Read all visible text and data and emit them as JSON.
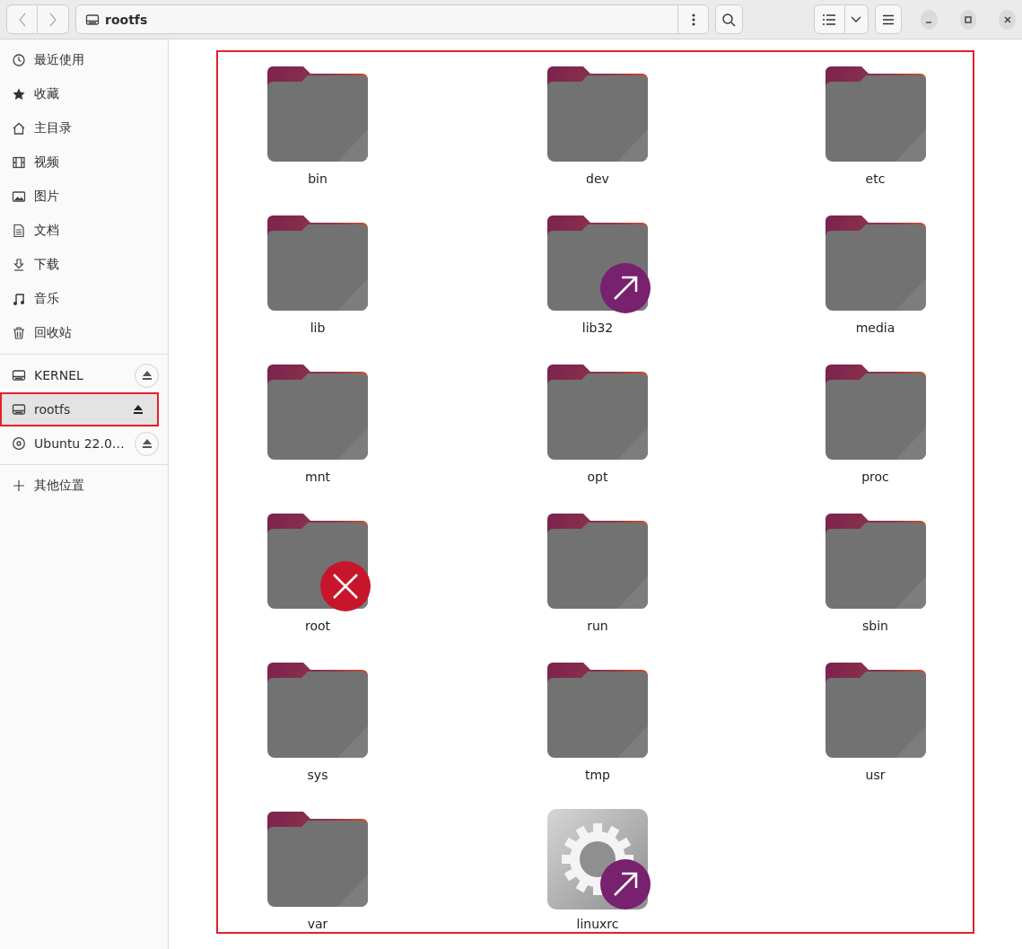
{
  "path_bar": {
    "location": "rootfs"
  },
  "sidebar": {
    "places": [
      {
        "label": "最近使用"
      },
      {
        "label": "收藏"
      },
      {
        "label": "主目录"
      },
      {
        "label": "视频"
      },
      {
        "label": "图片"
      },
      {
        "label": "文档"
      },
      {
        "label": "下载"
      },
      {
        "label": "音乐"
      },
      {
        "label": "回收站"
      }
    ],
    "devices": [
      {
        "label": "KERNEL",
        "selected": false,
        "highlighted": false,
        "kind": "drive"
      },
      {
        "label": "rootfs",
        "selected": true,
        "highlighted": true,
        "kind": "drive"
      },
      {
        "label": "Ubuntu 22.0…",
        "selected": false,
        "highlighted": false,
        "kind": "disc"
      }
    ],
    "other": {
      "label": "其他位置"
    }
  },
  "files": {
    "highlighted": true,
    "items": [
      {
        "name": "bin",
        "kind": "folder",
        "symlink": false,
        "unreadable": false
      },
      {
        "name": "dev",
        "kind": "folder",
        "symlink": false,
        "unreadable": false
      },
      {
        "name": "etc",
        "kind": "folder",
        "symlink": false,
        "unreadable": false
      },
      {
        "name": "lib",
        "kind": "folder",
        "symlink": false,
        "unreadable": false
      },
      {
        "name": "lib32",
        "kind": "folder",
        "symlink": true,
        "unreadable": false
      },
      {
        "name": "media",
        "kind": "folder",
        "symlink": false,
        "unreadable": false
      },
      {
        "name": "mnt",
        "kind": "folder",
        "symlink": false,
        "unreadable": false
      },
      {
        "name": "opt",
        "kind": "folder",
        "symlink": false,
        "unreadable": false
      },
      {
        "name": "proc",
        "kind": "folder",
        "symlink": false,
        "unreadable": false
      },
      {
        "name": "root",
        "kind": "folder",
        "symlink": false,
        "unreadable": true
      },
      {
        "name": "run",
        "kind": "folder",
        "symlink": false,
        "unreadable": false
      },
      {
        "name": "sbin",
        "kind": "folder",
        "symlink": false,
        "unreadable": false
      },
      {
        "name": "sys",
        "kind": "folder",
        "symlink": false,
        "unreadable": false
      },
      {
        "name": "tmp",
        "kind": "folder",
        "symlink": false,
        "unreadable": false
      },
      {
        "name": "usr",
        "kind": "folder",
        "symlink": false,
        "unreadable": false
      },
      {
        "name": "var",
        "kind": "folder",
        "symlink": false,
        "unreadable": false
      },
      {
        "name": "linuxrc",
        "kind": "executable",
        "symlink": true,
        "unreadable": false
      }
    ]
  }
}
